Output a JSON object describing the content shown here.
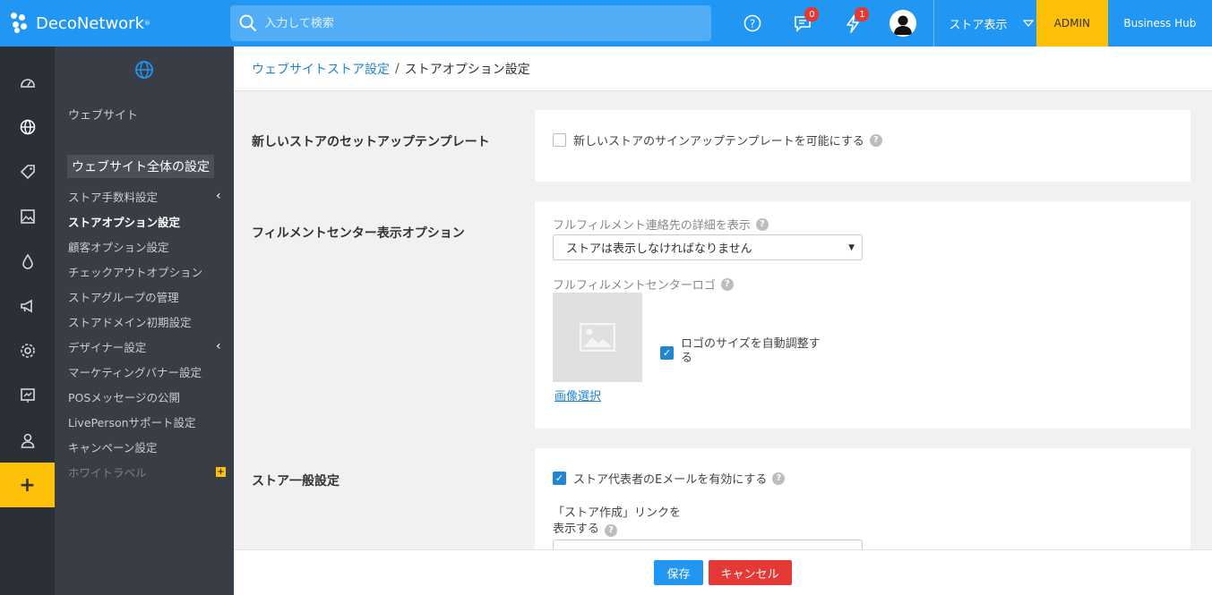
{
  "topbar": {
    "brand": "DecoNetwork",
    "search_placeholder": "入力して検索",
    "help_icon": "help-circle-icon",
    "messages_badge": "0",
    "alerts_badge": "1",
    "store_view_label": "ストア表示",
    "admin_label": "ADMIN",
    "hub_label": "Business Hub",
    "accent": "#2196f3",
    "admin_color": "#ffc107"
  },
  "rail": {
    "icons": [
      "dashboard-icon",
      "globe-icon",
      "tag-icon",
      "image-icon",
      "drop-icon",
      "megaphone-icon",
      "gear-icon",
      "chart-icon",
      "user-icon"
    ],
    "plus_label": "+"
  },
  "sidebar": {
    "section": "ウェブサイト",
    "heading": "ウェブサイト全体の設定",
    "items": [
      {
        "label": "ストア手数料設定"
      },
      {
        "label": "ストアオプション設定"
      },
      {
        "label": "顧客オプション設定"
      },
      {
        "label": "チェックアウトオプション"
      },
      {
        "label": "ストアグループの管理"
      },
      {
        "label": "ストアドメイン初期設定"
      },
      {
        "label": "デザイナー設定"
      },
      {
        "label": "マーケティングバナー設定"
      },
      {
        "label": "POSメッセージの公開"
      },
      {
        "label": "LivePersonサポート設定"
      },
      {
        "label": "キャンペーン設定"
      },
      {
        "label": "ホワイトラベル"
      }
    ]
  },
  "breadcrumb": {
    "parent": "ウェブサイトストア設定",
    "separator": "/",
    "current": "ストアオプション設定"
  },
  "sections": {
    "template": {
      "title": "新しいストアのセットアップテンプレート",
      "checkbox_label": "新しいストアのサインアップテンプレートを可能にする"
    },
    "fulfillment": {
      "title": "フィルメントセンター表示オプション",
      "contact_label": "フルフィルメント連絡先の詳細を表示",
      "contact_select": "ストアは表示しなければなりません",
      "logo_label": "フルフィルメントセンターロゴ",
      "auto_resize_label_1": "ロゴのサイズを自動調整す",
      "auto_resize_label_2": "る",
      "select_image": "画像選択"
    },
    "general": {
      "title": "ストア一般設定",
      "email_label": "ストア代表者のEメールを有効にする",
      "create_link_label_1": "「ストア作成」リンクを",
      "create_link_label_2": "表示する"
    }
  },
  "footer": {
    "save": "保存",
    "cancel": "キャンセル"
  }
}
